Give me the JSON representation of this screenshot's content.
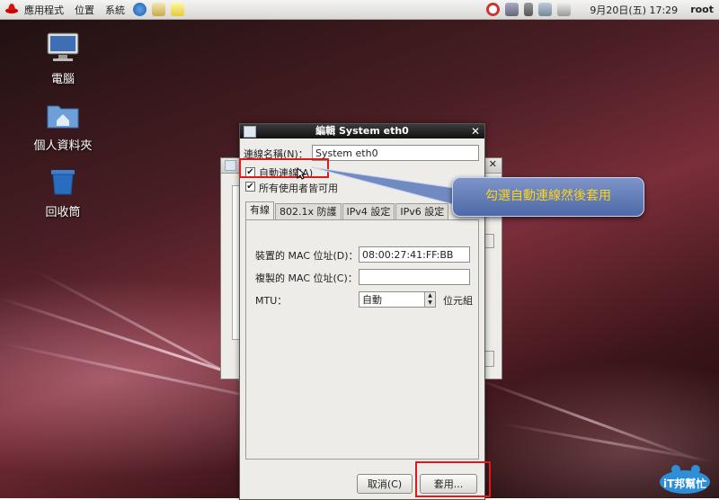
{
  "panel": {
    "menus": [
      "應用程式",
      "位置",
      "系統"
    ],
    "clock": "9月20日(五) 17:29",
    "user": "root"
  },
  "desktop_icons": [
    {
      "label": "電腦",
      "icon": "computer-icon"
    },
    {
      "label": "個人資料夾",
      "icon": "home-folder-icon"
    },
    {
      "label": "回收筒",
      "icon": "trash-icon"
    }
  ],
  "dialog": {
    "title": "編輯 System eth0",
    "connection_name_label": "連線名稱(N)：",
    "connection_name_value": "System eth0",
    "auto_connect_label": "自動連線(A)",
    "auto_connect_checked": true,
    "all_users_label": "所有使用者皆可用",
    "all_users_checked": true,
    "tabs": [
      "有線",
      "802.1x 防護",
      "IPv4 設定",
      "IPv6 設定"
    ],
    "active_tab": "有線",
    "device_mac_label": "裝置的 MAC 位址(D)：",
    "device_mac_value": "08:00:27:41:FF:BB",
    "cloned_mac_label": "複製的 MAC 位址(C)：",
    "cloned_mac_value": "",
    "mtu_label": "MTU：",
    "mtu_value": "自動",
    "mtu_unit": "位元組",
    "cancel_label": "取消(C)",
    "apply_label": "套用..."
  },
  "callout": {
    "text": "勾選自動連線然後套用"
  },
  "watermark": {
    "text": "iT邦幫忙"
  },
  "colors": {
    "highlight_box": "#e01a1a",
    "callout_bg": "#5a74b2",
    "callout_text": "#ffd21a"
  }
}
